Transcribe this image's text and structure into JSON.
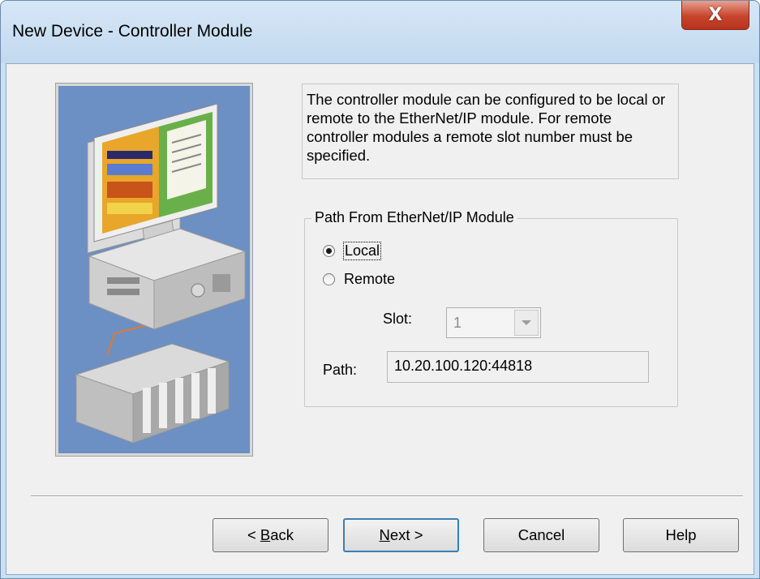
{
  "window": {
    "title": "New Device - Controller Module",
    "close_symbol": "X"
  },
  "description": "The controller module can be configured to be local or remote to the EtherNet/IP module. For remote controller modules a remote slot number must be specified.",
  "path_group": {
    "legend": "Path From EtherNet/IP Module",
    "radios": [
      {
        "label": "Local",
        "checked": true
      },
      {
        "label": "Remote",
        "checked": false
      }
    ],
    "slot_label": "Slot:",
    "slot_value": "1",
    "path_label": "Path:",
    "path_value": "10.20.100.120:44818"
  },
  "buttons": {
    "back": {
      "prefix": "< ",
      "mnemonic": "B",
      "rest": "ack"
    },
    "next": {
      "mnemonic": "N",
      "rest": "ext >"
    },
    "cancel": "Cancel",
    "help": "Help"
  },
  "icons": {
    "illustration": "computer-and-plc-illustration"
  }
}
